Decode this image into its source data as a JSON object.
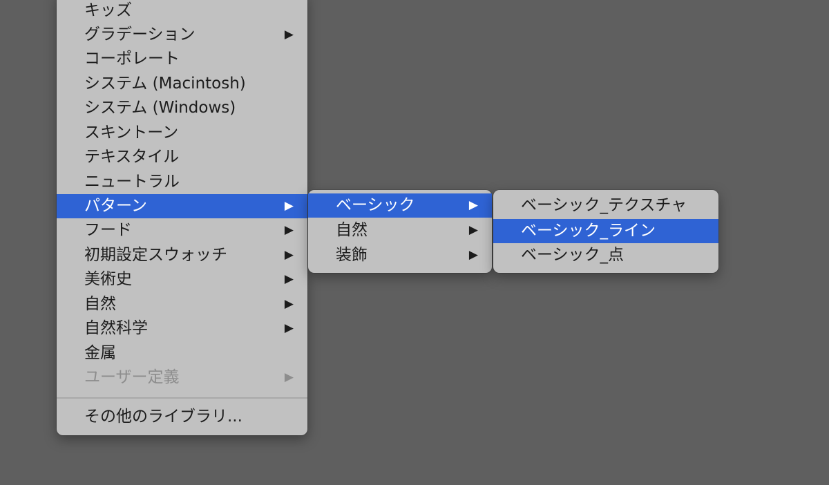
{
  "colors": {
    "desktop_background": "#5f5f5f",
    "menu_background": "#c1c1c1",
    "selection_highlight": "#2f63d4",
    "text": "#1c1c1c",
    "disabled_text": "#8d8d8d"
  },
  "submenu_arrow_glyph": "▶",
  "main_menu": {
    "items": [
      {
        "label": "キッズ",
        "has_submenu": false
      },
      {
        "label": "グラデーション",
        "has_submenu": true
      },
      {
        "label": "コーポレート",
        "has_submenu": false
      },
      {
        "label": "システム (Macintosh)",
        "has_submenu": false
      },
      {
        "label": "システム (Windows)",
        "has_submenu": false
      },
      {
        "label": "スキントーン",
        "has_submenu": false
      },
      {
        "label": "テキスタイル",
        "has_submenu": false
      },
      {
        "label": "ニュートラル",
        "has_submenu": false
      },
      {
        "label": "パターン",
        "has_submenu": true,
        "selected": true
      },
      {
        "label": "フード",
        "has_submenu": true
      },
      {
        "label": "初期設定スウォッチ",
        "has_submenu": true
      },
      {
        "label": "美術史",
        "has_submenu": true
      },
      {
        "label": "自然",
        "has_submenu": true
      },
      {
        "label": "自然科学",
        "has_submenu": true
      },
      {
        "label": "金属",
        "has_submenu": false
      },
      {
        "label": "ユーザー定義",
        "has_submenu": true,
        "disabled": true
      }
    ],
    "footer_item": {
      "label": "その他のライブラリ..."
    }
  },
  "pattern_submenu": {
    "items": [
      {
        "label": "ベーシック",
        "has_submenu": true,
        "selected": true
      },
      {
        "label": "自然",
        "has_submenu": true
      },
      {
        "label": "装飾",
        "has_submenu": true
      }
    ]
  },
  "basic_submenu": {
    "items": [
      {
        "label": "ベーシック_テクスチャ"
      },
      {
        "label": "ベーシック_ライン",
        "selected": true
      },
      {
        "label": "ベーシック_点"
      }
    ]
  }
}
